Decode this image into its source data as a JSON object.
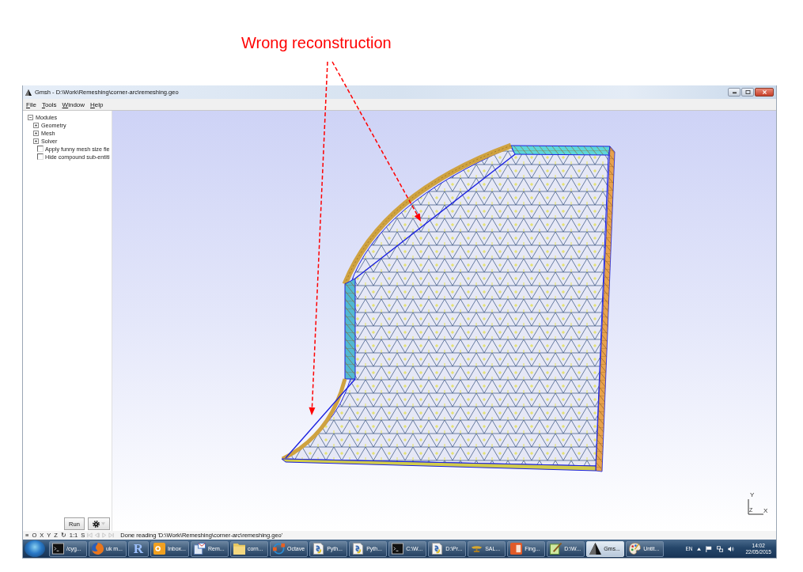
{
  "annotation": {
    "text": "Wrong reconstruction"
  },
  "window": {
    "title": "Gmsh - D:\\Work\\Remeshing\\corner-arc\\remeshing.geo"
  },
  "menu": [
    {
      "label": "File"
    },
    {
      "label": "Tools"
    },
    {
      "label": "Window"
    },
    {
      "label": "Help"
    }
  ],
  "tree": [
    {
      "kind": "folder",
      "label": "Modules",
      "expanded": true,
      "children": [
        {
          "kind": "folder",
          "label": "Geometry",
          "expanded": false
        },
        {
          "kind": "folder",
          "label": "Mesh",
          "expanded": false
        },
        {
          "kind": "folder",
          "label": "Solver",
          "expanded": false
        }
      ]
    },
    {
      "kind": "checkbox",
      "label": "Apply funny mesh size fie",
      "checked": false
    },
    {
      "kind": "checkbox",
      "label": "Hide compound sub-entiti",
      "checked": false
    }
  ],
  "run_button": {
    "label": "Run"
  },
  "viewport": {
    "axes": {
      "x": "X",
      "y": "Y",
      "z": "Z"
    }
  },
  "status_bar": {
    "buttons": [
      "≡",
      "O",
      "X",
      "Y",
      "Z",
      "↻",
      "1:1",
      "S"
    ],
    "playback": [
      {
        "kind": "first",
        "disabled": true
      },
      {
        "kind": "previous",
        "disabled": true
      },
      {
        "kind": "next",
        "disabled": true
      },
      {
        "kind": "last",
        "disabled": true
      }
    ],
    "message": "Done reading 'D:\\Work\\Remeshing\\corner-arc\\remeshing.geo'"
  },
  "taskbar": {
    "items": [
      {
        "kind": "console",
        "label": "/cyg...",
        "selected": false
      },
      {
        "kind": "browser",
        "label": "uk m...",
        "selected": false
      },
      {
        "kind": "letter",
        "label": "R",
        "selected": false
      },
      {
        "kind": "mail",
        "label": "Inbox...",
        "selected": false
      },
      {
        "kind": "message",
        "label": "Rem...",
        "selected": false
      },
      {
        "kind": "folder",
        "label": "corn...",
        "selected": false
      },
      {
        "kind": "ring",
        "label": "Octave",
        "selected": false
      },
      {
        "kind": "script",
        "label": "Pyth...",
        "selected": false
      },
      {
        "kind": "script",
        "label": "Pyth...",
        "selected": false
      },
      {
        "kind": "console",
        "label": "C:\\W...",
        "selected": false
      },
      {
        "kind": "script",
        "label": "D:\\Pr...",
        "selected": false
      },
      {
        "kind": "lamp",
        "label": "SAL...",
        "selected": false
      },
      {
        "kind": "slides",
        "label": "Fing...",
        "selected": false
      },
      {
        "kind": "editor",
        "label": "D:\\W...",
        "selected": false
      },
      {
        "kind": "triangle",
        "label": "Gms...",
        "selected": true
      },
      {
        "kind": "palette",
        "label": "Untit...",
        "selected": false
      }
    ],
    "tray": {
      "language": "EN",
      "time": "14:02",
      "date": "22/05/2015"
    }
  }
}
